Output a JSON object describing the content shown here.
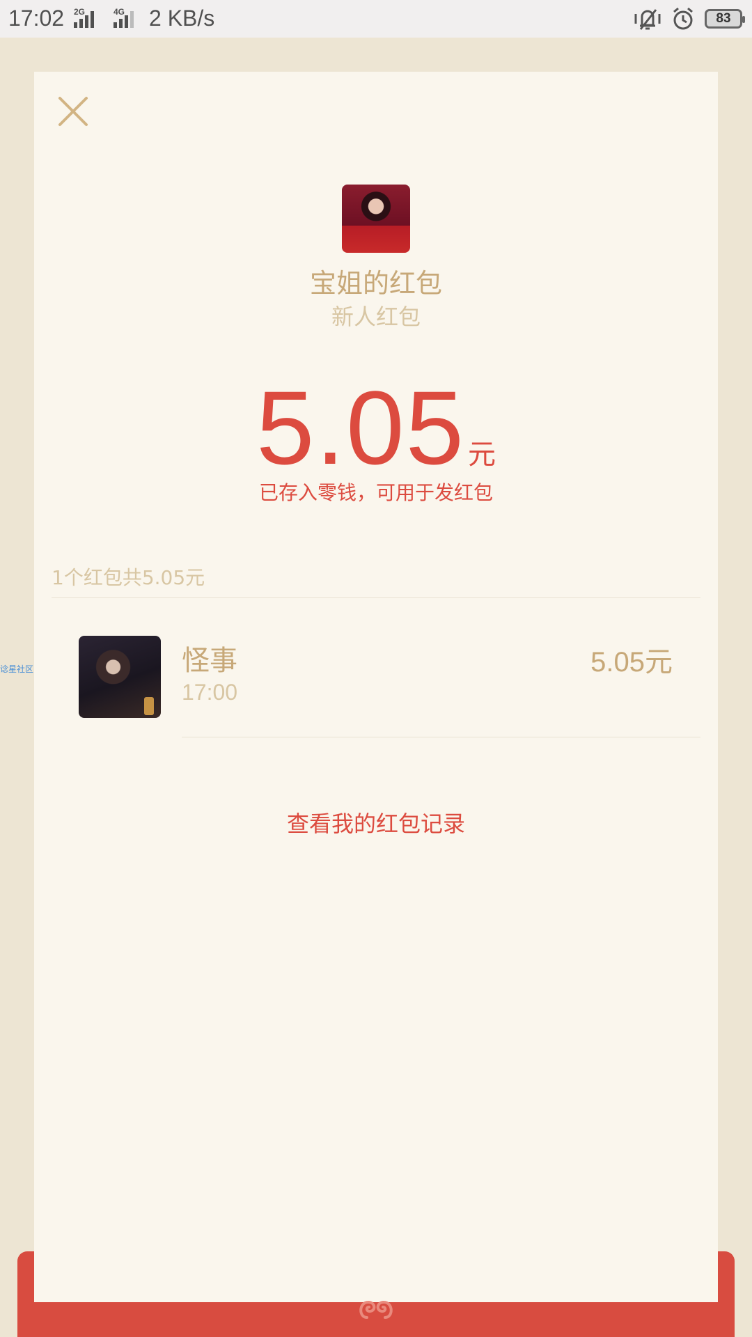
{
  "status_bar": {
    "time": "17:02",
    "sim1_label": "2G",
    "sim2_label": "4G",
    "net_speed": "2 KB/s",
    "battery": "83",
    "icons": [
      "vibrate-icon",
      "alarm-icon",
      "battery-icon"
    ]
  },
  "envelope": {
    "close_icon": "close-icon",
    "sender_title": "宝姐的红包",
    "sender_subtitle": "新人红包",
    "amount": "5.05",
    "amount_unit": "元",
    "stored_note": "已存入零钱，可用于发红包",
    "summary": "1个红包共5.05元",
    "history_link": "查看我的红包记录",
    "logo_icon": "wechat-pay-logo-icon"
  },
  "receivers": [
    {
      "name": "怪事",
      "time": "17:00",
      "amount": "5.05元"
    }
  ],
  "side_tag": "谂星社区",
  "colors": {
    "background": "#ede5d3",
    "card": "#faf6ed",
    "accent_red": "#dc4b3f",
    "gold": "#c7a878",
    "muted_gold": "#d8c6a3",
    "envelope_red": "#d84c40"
  }
}
